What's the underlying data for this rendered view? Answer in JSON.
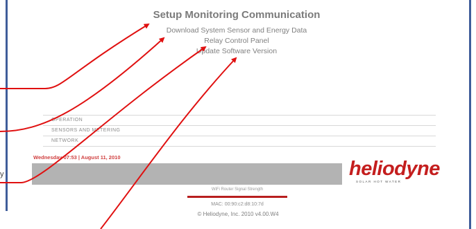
{
  "page": {
    "title": "Setup Monitoring Communication",
    "links": [
      "Download System Sensor and Energy Data",
      "Relay Control Panel",
      "Update Software Version"
    ]
  },
  "nav": {
    "items": [
      "OPERATION",
      "SENSORS AND METERING",
      "NETWORK"
    ]
  },
  "status": {
    "datetime": "Wednesday 07:53 | August 11, 2010"
  },
  "brand": {
    "name": "heliodyne",
    "tagline": "SOLAR HOT WATER",
    "color": "#c41e1e"
  },
  "footer": {
    "wifi_label": "WiFi Router Signal Strength",
    "wifi_level_percent": 100,
    "mac": "MAC: 00:90:c2:d8:10:7d",
    "copyright": "© Heliodyne, Inc. 2010 v4.00.W4"
  },
  "side_fragment": "y",
  "annotations": {
    "arrow_color": "#e01010"
  }
}
